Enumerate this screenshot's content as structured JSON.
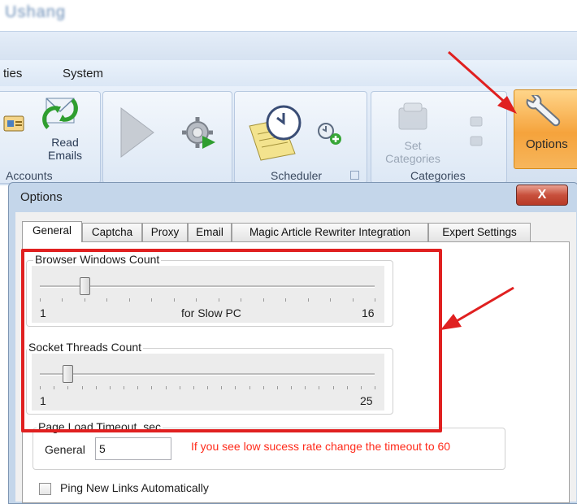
{
  "app": {
    "title": "Ushang"
  },
  "menu": {
    "items": [
      "ties",
      "System"
    ]
  },
  "ribbon": {
    "read_emails_label": "Read\nEmails",
    "accounts_group": "Accounts",
    "scheduler_group": "Scheduler",
    "set_categories_label": "Set\nCategories",
    "categories_group": "Categories",
    "options_label": "Options"
  },
  "dialog": {
    "title": "Options",
    "close_label": "X",
    "tabs": [
      "General",
      "Captcha",
      "Proxy",
      "Email",
      "Magic Article Rewriter Integration",
      "Expert Settings"
    ],
    "active_tab": "General",
    "browser_windows": {
      "legend": "Browser Windows Count",
      "min_label": "1",
      "mid_label": "for Slow PC",
      "max_label": "16",
      "value": 3
    },
    "socket_threads": {
      "legend": "Socket Threads Count",
      "min_label": "1",
      "max_label": "25",
      "value": 3
    },
    "page_load": {
      "legend": "Page Load Timeout, sec",
      "field_label": "General",
      "value": "5",
      "hint": "If you see low sucess  rate change the timeout to 60"
    },
    "ping_checkbox_label": "Ping New Links Automatically",
    "ping_checked": false
  },
  "colors": {
    "annotation_red": "#e02020",
    "options_orange": "#f5a33c",
    "hint_red": "#ff2a1a"
  }
}
